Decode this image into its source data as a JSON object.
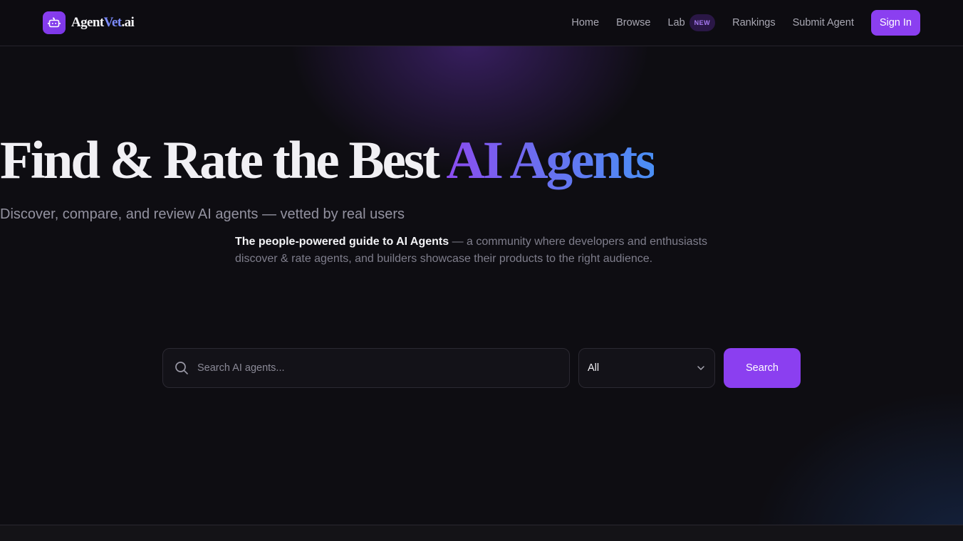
{
  "brand": {
    "name_part1": "Agent",
    "name_part2": "Vet",
    "name_part3": ".ai",
    "icon": "robot-icon",
    "color": "#8b3ff0"
  },
  "nav": {
    "links": [
      {
        "label": "Home"
      },
      {
        "label": "Browse"
      },
      {
        "label": "Lab",
        "badge": "NEW"
      },
      {
        "label": "Rankings"
      },
      {
        "label": "Submit Agent"
      }
    ],
    "signin_label": "Sign In"
  },
  "hero": {
    "title_main": "Find & Rate the Best ",
    "title_accent": "AI Agents",
    "subtitle": "Discover, compare, and review AI agents — vetted by real users",
    "desc_strong": "The people-powered guide to AI Agents",
    "desc_rest": " — a community where developers and enthusiasts discover & rate agents, and builders showcase their products to the right audience."
  },
  "search": {
    "placeholder": "Search AI agents...",
    "icon": "search-icon",
    "filter_value": "All",
    "filter_icon": "chevron-down-icon",
    "button_label": "Search"
  },
  "colors": {
    "accent": "#8b3ff0",
    "gradient_start": "#8b4cf0",
    "gradient_end": "#4a8ff5",
    "background": "#0e0d12"
  }
}
